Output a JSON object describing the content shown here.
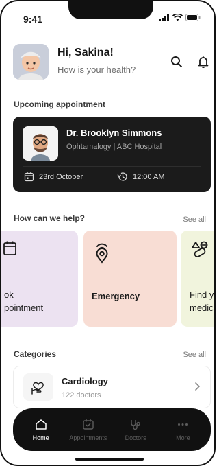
{
  "status_bar": {
    "time": "9:41"
  },
  "header": {
    "greeting": "Hi, Sakina!",
    "subtitle": "How is your health?"
  },
  "upcoming": {
    "title": "Upcoming appointment",
    "doctor_name": "Dr. Brooklyn Simmons",
    "specialty": "Ophtamalogy | ABC Hospital",
    "date": "23rd October",
    "time": "12:00 AM"
  },
  "help": {
    "title": "How can we help?",
    "see_all": "See all",
    "cards": [
      {
        "label": "ok\npointment",
        "icon": "calendar-icon",
        "color": "#ece2f1"
      },
      {
        "label": "Emergency",
        "icon": "emergency-beacon-icon",
        "color": "#f8ddd4"
      },
      {
        "label": "Find y\nmedic",
        "icon": "pills-icon",
        "color": "#f1f4dd"
      }
    ]
  },
  "categories": {
    "title": "Categories",
    "see_all": "See all",
    "items": [
      {
        "name": "Cardiology",
        "count": "122 doctors",
        "icon": "heart-hand-icon"
      }
    ]
  },
  "tabs": [
    {
      "label": "Home",
      "icon": "home-icon",
      "active": true
    },
    {
      "label": "Appointments",
      "icon": "calendar-check-icon",
      "active": false
    },
    {
      "label": "Doctors",
      "icon": "stethoscope-icon",
      "active": false
    },
    {
      "label": "More",
      "icon": "more-dots-icon",
      "active": false
    }
  ],
  "colors": {
    "card_dark": "#1b1b1b",
    "tab_bar": "#111111"
  }
}
